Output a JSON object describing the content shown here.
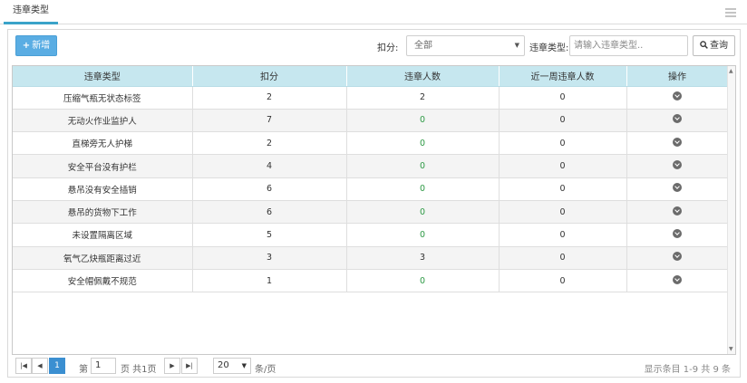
{
  "tab": {
    "label": "违章类型"
  },
  "toolbar": {
    "add_label": "新增",
    "score_label": "扣分:",
    "score_select_value": "全部",
    "type_label": "违章类型:",
    "type_placeholder": "请输入违章类型..",
    "search_label": "查询"
  },
  "table": {
    "headers": [
      "违章类型",
      "扣分",
      "违章人数",
      "近一周违章人数",
      "操作"
    ],
    "rows": [
      {
        "type": "压缩气瓶无状态标签",
        "score": "2",
        "count": "2",
        "week": "0"
      },
      {
        "type": "无动火作业监护人",
        "score": "7",
        "count": "0",
        "week": "0"
      },
      {
        "type": "直梯旁无人护梯",
        "score": "2",
        "count": "0",
        "week": "0"
      },
      {
        "type": "安全平台没有护栏",
        "score": "4",
        "count": "0",
        "week": "0"
      },
      {
        "type": "悬吊没有安全插销",
        "score": "6",
        "count": "0",
        "week": "0"
      },
      {
        "type": "悬吊的货物下工作",
        "score": "6",
        "count": "0",
        "week": "0"
      },
      {
        "type": "未设置隔离区域",
        "score": "5",
        "count": "0",
        "week": "0"
      },
      {
        "type": "氧气乙炔瓶距离过近",
        "score": "3",
        "count": "3",
        "week": "0"
      },
      {
        "type": "安全帽佩戴不规范",
        "score": "1",
        "count": "0",
        "week": "0"
      }
    ],
    "op_icon": "chevron-down-circle-icon"
  },
  "pager": {
    "page_prefix": "第",
    "page_value": "1",
    "page_suffix": "页 共1页",
    "current_page": "1",
    "page_size": "20",
    "page_size_suffix": "条/页",
    "info": "显示条目 1-9 共 9 条"
  },
  "colors": {
    "accent": "#3aa3c9",
    "add_button": "#5aade3",
    "header_bg": "#c6e7ef",
    "active_page": "#3b8fd1",
    "count_text": "#2e9a45"
  }
}
